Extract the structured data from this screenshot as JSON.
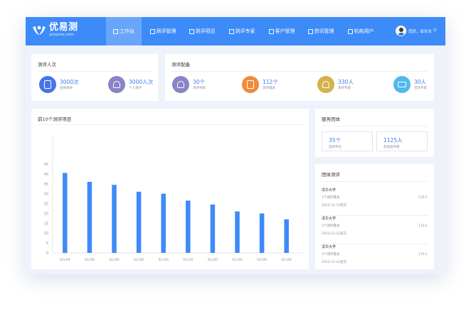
{
  "brand": {
    "name": "优易测",
    "domain": "youyice.com",
    "color": "#3d8bf8"
  },
  "nav": {
    "items": [
      {
        "label": "工作台",
        "icon": "monitor-icon",
        "active": true
      },
      {
        "label": "测评管理",
        "icon": "clipboard-icon"
      },
      {
        "label": "测评项目",
        "icon": "document-icon"
      },
      {
        "label": "测评专家",
        "icon": "experts-icon"
      },
      {
        "label": "客户管理",
        "icon": "customers-icon"
      },
      {
        "label": "资讯管理",
        "icon": "news-icon"
      },
      {
        "label": "机构用户",
        "icon": "users-icon"
      }
    ],
    "user": "您好，亚长长"
  },
  "test_count": {
    "title": "测评人次",
    "stats": [
      {
        "value": "3000次",
        "label": "团体测评",
        "color": "#4775e8",
        "icon": "pen-icon"
      },
      {
        "value": "3000人次",
        "label": "个人测评",
        "color": "#8a83c7",
        "icon": "person-icon"
      }
    ]
  },
  "config": {
    "title": "测评配备",
    "stats": [
      {
        "value": "30个",
        "label": "测评项目",
        "color": "#8a83c7",
        "icon": "user-gear-icon"
      },
      {
        "value": "112个",
        "label": "测评量表",
        "color": "#f08b3a",
        "icon": "document-icon"
      },
      {
        "value": "330人",
        "label": "测评专家",
        "color": "#d4b24c",
        "icon": "expert-icon"
      },
      {
        "value": "30人",
        "label": "咨询专家",
        "color": "#4fb9ee",
        "icon": "mortarboard-icon"
      }
    ]
  },
  "service": {
    "title": "服务团体",
    "boxes": [
      {
        "value": "35个",
        "label": "团体单位"
      },
      {
        "value": "1125人",
        "label": "参加测评者"
      }
    ]
  },
  "group_tests": {
    "title": "团体测评",
    "items": [
      {
        "name": "清华大学",
        "count": "3个测评量表",
        "date": "2022-12-12提交",
        "people": "115人"
      },
      {
        "name": "清华大学",
        "count": "3个测评量表",
        "date": "2022-12-12提交",
        "people": "115人"
      },
      {
        "name": "清华大学",
        "count": "3个测评量表",
        "date": "2022-12-12提交",
        "people": "115人"
      }
    ]
  },
  "chart_data": {
    "type": "bar",
    "title": "前10个测评项目",
    "categories": [
      "SCL90",
      "SCL90",
      "SCL90",
      "SCL90",
      "SCL90",
      "SCL90",
      "SCL90",
      "SCL90",
      "SCL90",
      "SCL90"
    ],
    "values": [
      40.5,
      36,
      34.5,
      31,
      30,
      26.5,
      24.5,
      21,
      20,
      17
    ],
    "yticks": [
      0,
      5,
      10,
      15,
      20,
      25,
      30,
      35,
      40,
      45
    ],
    "ylim": [
      0,
      45
    ],
    "bar_color": "#3d8bf8",
    "grid": false
  }
}
